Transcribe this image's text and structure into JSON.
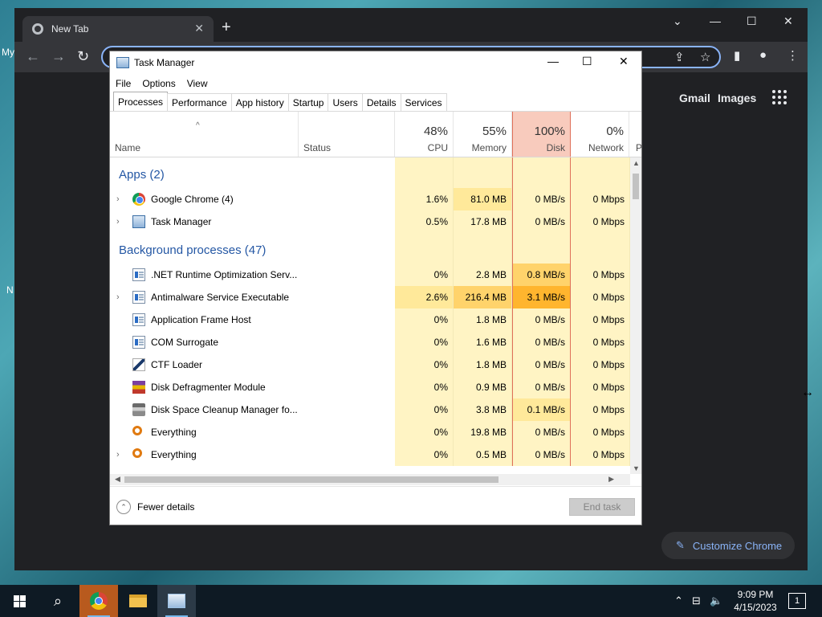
{
  "desktop": {
    "labels": [
      "My",
      "N"
    ]
  },
  "chrome": {
    "tab_title": "New Tab",
    "tab_close": "✕",
    "new_tab": "+",
    "win_min": "⌄",
    "win_minimize": "—",
    "win_max": "☐",
    "win_close": "✕",
    "back": "←",
    "forward": "→",
    "reload": "↻",
    "share": "⇪",
    "star": "☆",
    "side_panel": "▮",
    "profile": "●",
    "menu": "⋮",
    "gmail": "Gmail",
    "images": "Images",
    "customize": "Customize Chrome",
    "customize_icon": "✎"
  },
  "taskmanager": {
    "title": "Task Manager",
    "ctrl_min": "—",
    "ctrl_max": "☐",
    "ctrl_close": "✕",
    "menu": [
      "File",
      "Options",
      "View"
    ],
    "tabs": [
      "Processes",
      "Performance",
      "App history",
      "Startup",
      "Users",
      "Details",
      "Services"
    ],
    "active_tab": 0,
    "sort_arrow": "^",
    "columns": {
      "name": "Name",
      "status": "Status",
      "cpu": {
        "pct": "48%",
        "label": "CPU"
      },
      "memory": {
        "pct": "55%",
        "label": "Memory"
      },
      "disk": {
        "pct": "100%",
        "label": "Disk"
      },
      "network": {
        "pct": "0%",
        "label": "Network"
      },
      "power": "P"
    },
    "groups": {
      "apps": "Apps (2)",
      "background": "Background processes (47)"
    },
    "apps": [
      {
        "name": "Google Chrome (4)",
        "expand": "›",
        "icon": "chrome-icon",
        "cpu": "1.6%",
        "memory": "81.0 MB",
        "disk": "0 MB/s",
        "network": "0 Mbps"
      },
      {
        "name": "Task Manager",
        "expand": "›",
        "icon": "task-manager-icon",
        "cpu": "0.5%",
        "memory": "17.8 MB",
        "disk": "0 MB/s",
        "network": "0 Mbps"
      }
    ],
    "background": [
      {
        "name": ".NET Runtime Optimization Serv...",
        "expand": "",
        "icon": "window-icon",
        "cpu": "0%",
        "memory": "2.8 MB",
        "disk": "0.8 MB/s",
        "network": "0 Mbps"
      },
      {
        "name": "Antimalware Service Executable",
        "expand": "›",
        "icon": "window-icon",
        "cpu": "2.6%",
        "memory": "216.4 MB",
        "disk": "3.1 MB/s",
        "network": "0 Mbps"
      },
      {
        "name": "Application Frame Host",
        "expand": "",
        "icon": "window-icon",
        "cpu": "0%",
        "memory": "1.8 MB",
        "disk": "0 MB/s",
        "network": "0 Mbps"
      },
      {
        "name": "COM Surrogate",
        "expand": "",
        "icon": "window-icon",
        "cpu": "0%",
        "memory": "1.6 MB",
        "disk": "0 MB/s",
        "network": "0 Mbps"
      },
      {
        "name": "CTF Loader",
        "expand": "",
        "icon": "pen-icon",
        "cpu": "0%",
        "memory": "1.8 MB",
        "disk": "0 MB/s",
        "network": "0 Mbps"
      },
      {
        "name": "Disk Defragmenter Module",
        "expand": "",
        "icon": "defrag-icon",
        "cpu": "0%",
        "memory": "0.9 MB",
        "disk": "0 MB/s",
        "network": "0 Mbps"
      },
      {
        "name": "Disk Space Cleanup Manager fo...",
        "expand": "",
        "icon": "cleanup-icon",
        "cpu": "0%",
        "memory": "3.8 MB",
        "disk": "0.1 MB/s",
        "network": "0 Mbps"
      },
      {
        "name": "Everything",
        "expand": "",
        "icon": "search-icon",
        "cpu": "0%",
        "memory": "19.8 MB",
        "disk": "0 MB/s",
        "network": "0 Mbps"
      },
      {
        "name": "Everything",
        "expand": "›",
        "icon": "search-icon",
        "cpu": "0%",
        "memory": "0.5 MB",
        "disk": "0 MB/s",
        "network": "0 Mbps"
      }
    ],
    "scroll_up": "▲",
    "scroll_down": "▼",
    "scroll_left": "◀",
    "scroll_right": "▶",
    "fewer_icon": "⌃",
    "fewer_details": "Fewer details",
    "end_task": "End task"
  },
  "taskbar": {
    "time": "9:09 PM",
    "date": "4/15/2023",
    "notifications": "1",
    "tray_chevron": "⌃",
    "tray_network": "⊟",
    "tray_volume": "🔈",
    "search": "⌕"
  },
  "colors": {
    "disk_header_bg": "#f8cbbd",
    "disk_border": "#e0705a",
    "heat_low": "#fff4c4",
    "heat_mid": "#ffe99a",
    "heat_high": "#ffd36b",
    "heat_max": "#ffb52e",
    "group_blue": "#2457a4"
  }
}
